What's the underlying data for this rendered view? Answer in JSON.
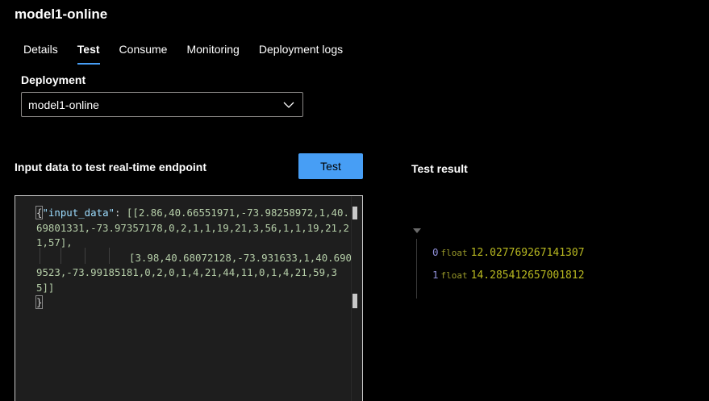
{
  "page": {
    "title": "model1-online"
  },
  "tabs": [
    {
      "label": "Details",
      "active": false
    },
    {
      "label": "Test",
      "active": true
    },
    {
      "label": "Consume",
      "active": false
    },
    {
      "label": "Monitoring",
      "active": false
    },
    {
      "label": "Deployment logs",
      "active": false
    }
  ],
  "deployment": {
    "label": "Deployment",
    "selected": "model1-online",
    "chevron_icon": "chevron-down-icon"
  },
  "input": {
    "heading": "Input data to test real-time endpoint",
    "test_button": "Test",
    "code": {
      "open_brace": "{",
      "key": "\"input_data\"",
      "colon": ": ",
      "row1": "[[2.86,40.66551971,-73.98258972,1,40.69801331,-73.97357178,0,2,1,1,19,21,3,56,1,1,19,21,21,57],",
      "row2": "[3.98,40.68072128,-73.931633,1,40.6909523,-73.99185181,0,2,0,1,4,21,44,11,0,1,4,21,59,35]]",
      "close_brace": "}"
    }
  },
  "result": {
    "heading": "Test result",
    "items": [
      {
        "index": "0",
        "type": "float",
        "value": "12.027769267141307"
      },
      {
        "index": "1",
        "type": "float",
        "value": "14.285412657001812"
      }
    ]
  },
  "colors": {
    "accent": "#479ef5",
    "background": "#000000",
    "editor_bg": "#1e1e1e"
  }
}
